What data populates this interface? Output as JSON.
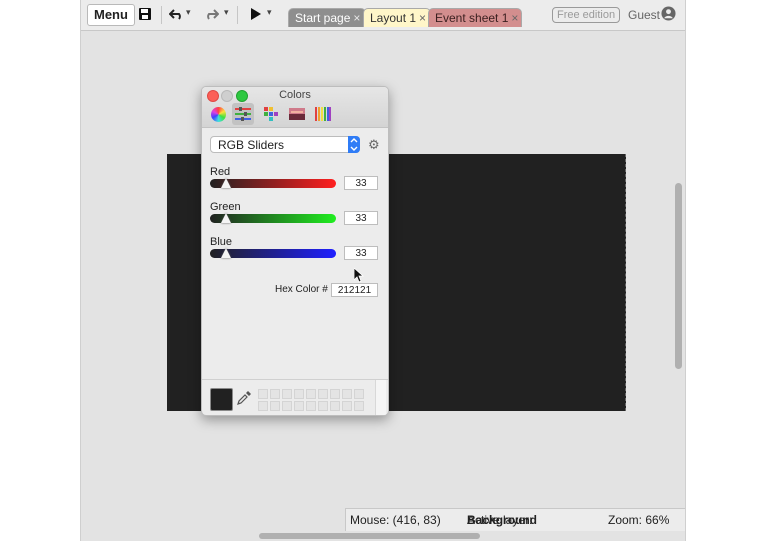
{
  "toolbar": {
    "menu_label": "Menu",
    "save_icon": "floppy-disk-icon",
    "undo_icon": "undo-icon",
    "redo_icon": "redo-icon",
    "run_icon": "play-icon",
    "dropdown_glyph": "▾",
    "free_edition_label": "Free edition",
    "user_label": "Guest",
    "user_icon": "user-circle-icon"
  },
  "tabs": [
    {
      "label": "Start page",
      "close": "×",
      "color": "#8e8e8e"
    },
    {
      "label": "Layout 1",
      "close": "×",
      "color": "#fff6c9",
      "active": true
    },
    {
      "label": "Event sheet 1",
      "close": "×",
      "color": "#d38e8e"
    }
  ],
  "canvas": {
    "background": "#212121"
  },
  "colors_panel": {
    "title": "Colors",
    "modes": [
      "color-wheel-icon",
      "sliders-icon",
      "palettes-icon",
      "image-palettes-icon",
      "pencils-icon"
    ],
    "active_mode": "sliders-icon",
    "mode_select": "RGB Sliders",
    "sliders": [
      {
        "label": "Red",
        "value": "33",
        "fraction": 0.129
      },
      {
        "label": "Green",
        "value": "33",
        "fraction": 0.129
      },
      {
        "label": "Blue",
        "value": "33",
        "fraction": 0.129
      }
    ],
    "hex_label": "Hex Color #",
    "hex_value": "212121",
    "current_color": "#212121"
  },
  "statusbar": {
    "mouse": "Mouse: (416, 83)",
    "active_layer_label": "Active layer:",
    "active_layer_value": "Background",
    "zoom": "Zoom: 66%"
  }
}
